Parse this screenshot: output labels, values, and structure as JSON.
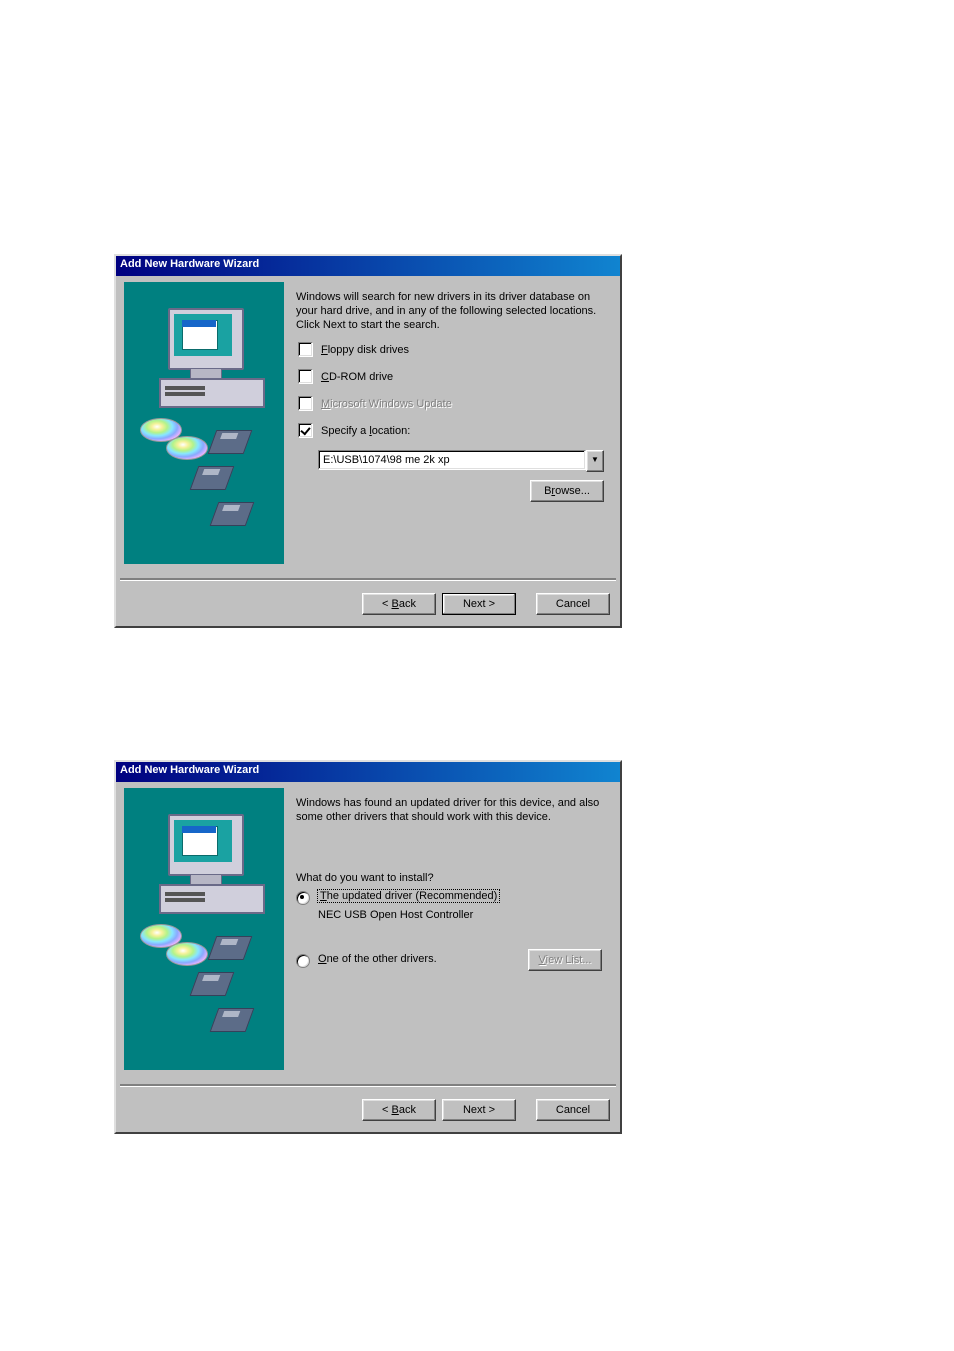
{
  "dialog1": {
    "title": "Add New Hardware Wizard",
    "instructions": "Windows will search for new drivers in its driver database on your hard drive, and in any of the following selected locations. Click Next to start the search.",
    "checks": {
      "floppy": {
        "label_pre": "",
        "akey": "F",
        "label_post": "loppy disk drives",
        "checked": false,
        "disabled": false
      },
      "cdrom": {
        "label_pre": "",
        "akey": "C",
        "label_post": "D-ROM drive",
        "checked": false,
        "disabled": false
      },
      "msupd": {
        "label_pre": "",
        "akey": "M",
        "label_post": "icrosoft Windows Update",
        "checked": false,
        "disabled": true
      },
      "specify": {
        "label_pre": "Specify a ",
        "akey": "l",
        "label_post": "ocation:",
        "checked": true,
        "disabled": false
      }
    },
    "location_value": "E:\\USB\\1074\\98 me 2k xp",
    "browse_pre": "B",
    "browse_akey": "r",
    "browse_post": "owse...",
    "buttons": {
      "back_pre": "< ",
      "back_akey": "B",
      "back_post": "ack",
      "next": "Next >",
      "cancel": "Cancel"
    }
  },
  "dialog2": {
    "title": "Add New Hardware Wizard",
    "intro": "Windows has found an updated driver for this device, and also some other drivers that should work with this device.",
    "question": "What do you want to install?",
    "radios": {
      "updated": {
        "akey": "T",
        "rest": "he updated driver (Recommended)",
        "sub": "NEC USB Open Host Controller"
      },
      "other": {
        "akey": "O",
        "rest": "ne of the other drivers."
      }
    },
    "viewlist_pre": "",
    "viewlist_akey": "V",
    "viewlist_post": "iew List...",
    "buttons": {
      "back_pre": "< ",
      "back_akey": "B",
      "back_post": "ack",
      "next": "Next >",
      "cancel": "Cancel"
    }
  }
}
